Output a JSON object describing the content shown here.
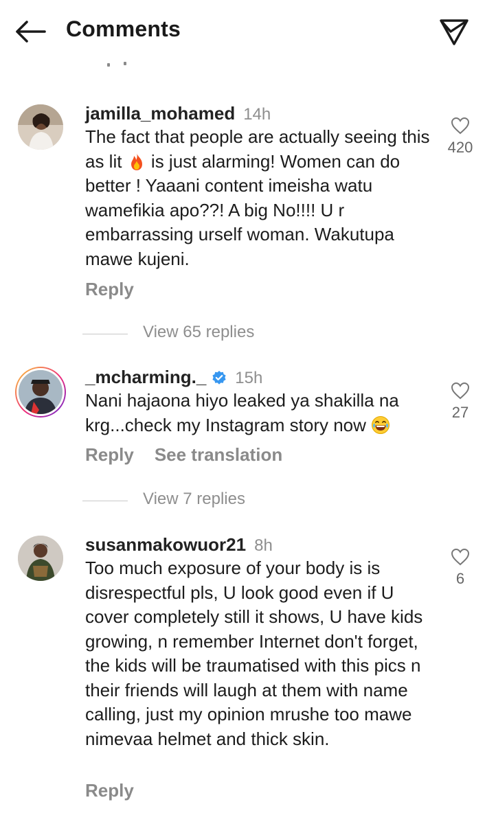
{
  "header": {
    "title": "Comments",
    "back_icon": "arrow-left-icon",
    "send_icon": "paper-plane-icon"
  },
  "comments": [
    {
      "username": "jamilla_mohamed",
      "time": "14h",
      "verified": false,
      "body_parts": [
        "The fact that people are actually seeing this as lit ",
        " is just alarming! Women can do better ! Yaaani content imeisha watu wamefikia apo??! A big No!!!! U r embarrassing urself woman. Wakutupa mawe kujeni."
      ],
      "emoji": "fire-emoji",
      "reply_label": "Reply",
      "likes": "420",
      "view_replies": "View 65 replies"
    },
    {
      "username": "_mcharming._",
      "time": "15h",
      "verified": true,
      "body_parts": [
        "Nani hajaona hiyo leaked ya shakilla  na krg...check my Instagram story now ",
        ""
      ],
      "emoji": "laughing-emoji",
      "reply_label": "Reply",
      "translate_label": "See translation",
      "likes": "27",
      "view_replies": "View 7 replies"
    },
    {
      "username": "susanmakowuor21",
      "time": "8h",
      "verified": false,
      "body_parts": [
        "Too much exposure of your body is  is disrespectful pls, U look good even if U cover completely still it shows,  U have kids growing,  n remember Internet don't forget,  the kids will be traumatised with this pics n their friends will laugh at them with name calling,  just my opinion mrushe too mawe nimevaa helmet and thick skin.",
        ""
      ],
      "reply_label": "Reply",
      "likes": "6"
    }
  ],
  "colors": {
    "text": "#1c1c1c",
    "muted": "#8e8e8e",
    "verified_blue": "#3797f0",
    "story_ring": [
      "#f9ce34",
      "#ee2a7b",
      "#6228d7"
    ]
  }
}
